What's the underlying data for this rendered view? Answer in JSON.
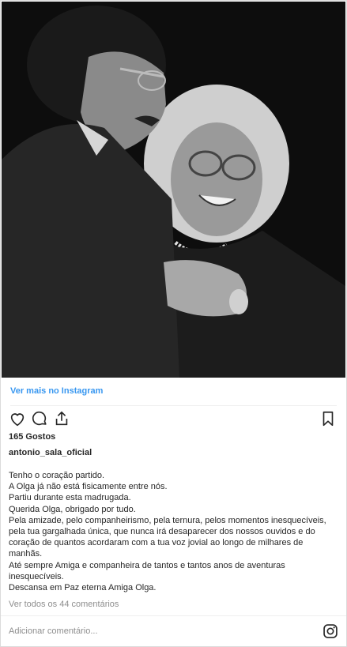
{
  "post": {
    "view_more_label": "Ver mais no Instagram",
    "likes": "165 Gostos",
    "username": "antonio_sala_oficial",
    "caption_lines": [
      "Tenho o coração partido.",
      "A Olga já não está fisicamente entre nós.",
      "Partiu durante esta madrugada.",
      "Querida Olga, obrigado por tudo.",
      "Pela amizade, pelo companheirismo, pela ternura, pelos momentos inesquecíveis, pela tua gargalhada única, que nunca irá desaparecer dos nossos ouvidos e do coração de quantos acordaram com a tua voz jovial ao longo de milhares de manhãs.",
      "Até sempre Amiga e companheira de tantos e tantos anos de aventuras inesquecíveis.",
      "Descansa em Paz eterna Amiga Olga."
    ],
    "view_comments_label": "Ver todos os 44 comentários",
    "add_comment_placeholder": "Adicionar comentário..."
  },
  "icons": {
    "like": "heart-icon",
    "comment": "comment-bubble-icon",
    "share": "share-icon",
    "save": "bookmark-icon",
    "brand": "instagram-icon"
  },
  "colors": {
    "link": "#3897f0",
    "text": "#262626",
    "muted": "#8e8e8e",
    "border": "#dbdbdb"
  }
}
